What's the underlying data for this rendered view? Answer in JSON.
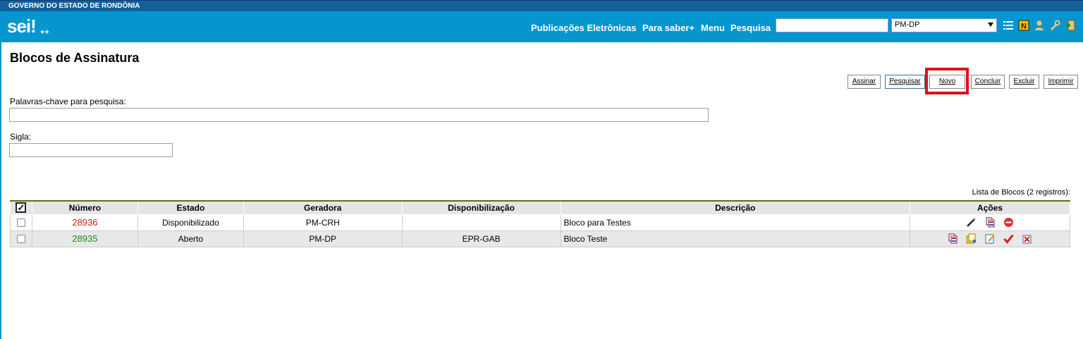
{
  "header": {
    "government": "GOVERNO DO ESTADO DE RONDÔNIA",
    "logo": "sei!",
    "logo_sup": "++",
    "nav": [
      "Publicações Eletrônicas",
      "Para saber+",
      "Menu",
      "Pesquisa"
    ],
    "search_value": "",
    "unit_selected": "PM-DP",
    "icons": [
      "list-icon",
      "notes-icon",
      "user-icon",
      "tools-icon",
      "exit-icon"
    ]
  },
  "page": {
    "title": "Blocos de Assinatura"
  },
  "toolbar": {
    "assinar": "Assinar",
    "pesquisar": "Pesquisar",
    "novo": "Novo",
    "concluir": "Concluir",
    "excluir": "Excluir",
    "imprimir": "Imprimir"
  },
  "form": {
    "keywords_label": "Palavras-chave para pesquisa:",
    "keywords_value": "",
    "sigla_label": "Sigla:",
    "sigla_value": ""
  },
  "table": {
    "caption": "Lista de Blocos (2 registros):",
    "headers": [
      "Número",
      "Estado",
      "Geradora",
      "Disponibilização",
      "Descrição",
      "Ações"
    ],
    "rows": [
      {
        "numero": "28936",
        "estado": "Disponibilizado",
        "geradora": "PM-CRH",
        "disponibilizacao": "",
        "descricao": "Bloco para Testes",
        "actions": [
          "sign-pen-icon",
          "documents-icon",
          "cancel-icon"
        ]
      },
      {
        "numero": "28935",
        "estado": "Aberto",
        "geradora": "PM-DP",
        "disponibilizacao": "EPR-GAB",
        "descricao": "Bloco Teste",
        "actions": [
          "documents-icon",
          "folder-icon",
          "edit-icon",
          "check-icon",
          "delete-icon"
        ]
      }
    ]
  },
  "colors": {
    "gov_bar": "#155f9b",
    "top_bar": "#0596cf",
    "highlight": "#e0101a",
    "num_red": "#d71a1a",
    "num_green": "#1a8a1a"
  }
}
